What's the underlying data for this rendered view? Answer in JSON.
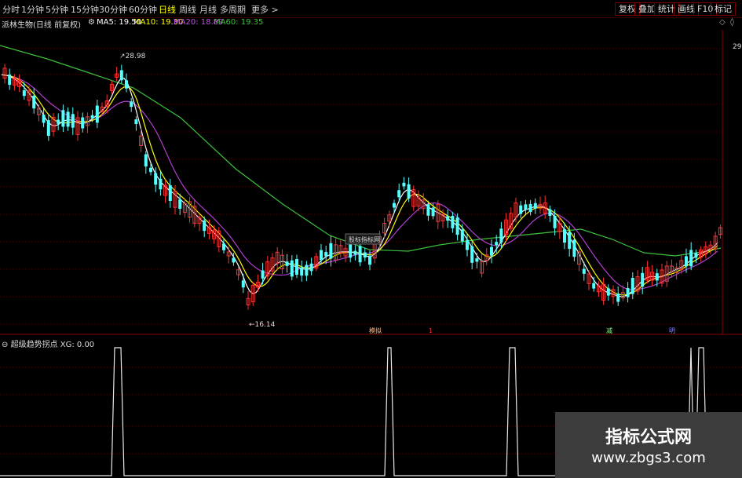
{
  "toolbar": {
    "tabs": [
      "分时",
      "1分钟",
      "5分钟",
      "15分钟",
      "30分钟",
      "60分钟",
      "日线",
      "周线",
      "月线",
      "多周期",
      "更多 >"
    ],
    "active_tab": "日线",
    "right_buttons": [
      "复权",
      "叠加",
      "统计",
      "画线",
      "F10",
      "标记"
    ]
  },
  "header": {
    "stock_name": "派林生物(日线 前复权)",
    "ma5_label": "MA5: 19.50",
    "ma10_label": "MA10: 19.30",
    "ma20_label": "MA20: 18.89",
    "ma60_label": "MA60: 19.35"
  },
  "main_chart": {
    "high_label": "28.98",
    "low_label": "16.14",
    "overlay_label": "股标指标网",
    "right_axis_value": "29",
    "event_labels": [
      "模拟",
      "1",
      "减",
      "明"
    ],
    "colors": {
      "ma5": "#ffffff",
      "ma10": "#ffff00",
      "ma20": "#b040d0",
      "ma60": "#3cc03c",
      "up": "#ff3030",
      "down": "#54ffff"
    }
  },
  "sub_chart": {
    "title": "超级趋势拐点  XG: 0.00"
  },
  "watermark": {
    "title": "指标公式网",
    "url": "www.zbgs3.com"
  }
}
